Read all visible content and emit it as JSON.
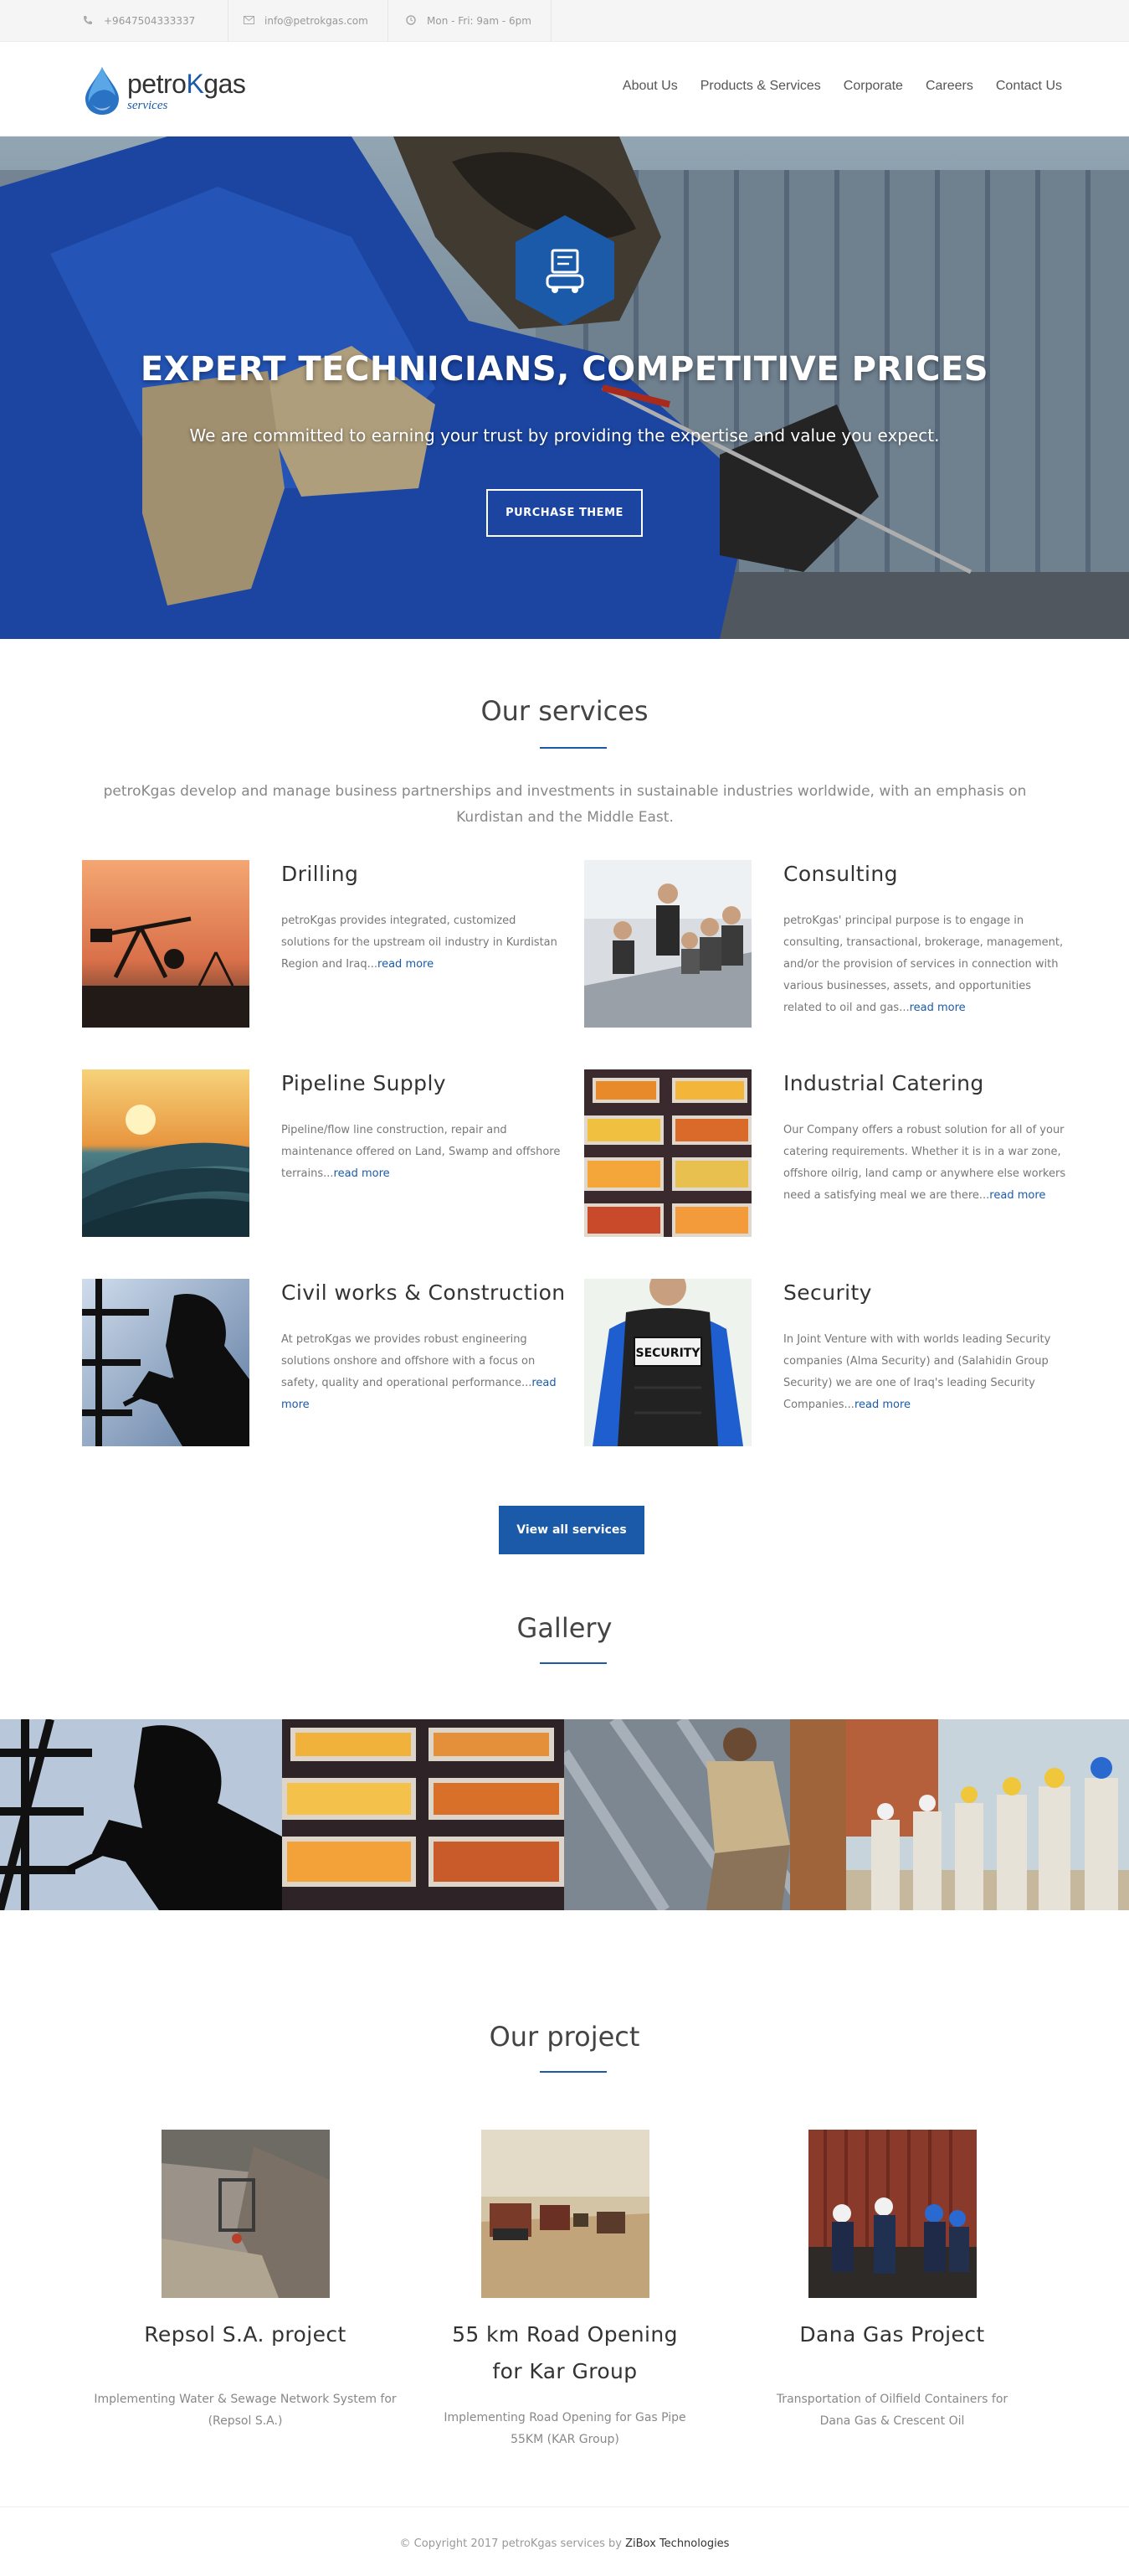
{
  "topbar": {
    "phone": "+9647504333337",
    "email": "info@petrokgas.com",
    "hours": "Mon - Fri: 9am - 6pm"
  },
  "logo": {
    "name_a": "petro",
    "name_k": "K",
    "name_b": "gas",
    "sub": "services"
  },
  "nav": [
    "About Us",
    "Products & Services",
    "Corporate",
    "Careers",
    "Contact Us"
  ],
  "hero": {
    "title": "EXPERT TECHNICIANS, COMPETITIVE PRICES",
    "subtitle": "We are committed to earning your trust by providing the expertise and value you expect.",
    "button": "PURCHASE THEME"
  },
  "services": {
    "title": "Our services",
    "intro": "petroKgas develop and manage business partnerships and investments in sustainable industries worldwide, with an emphasis on Kurdistan and the Middle East.",
    "items": [
      {
        "title": "Drilling",
        "desc": "petroKgas provides integrated, customized solutions for the upstream oil industry in Kurdistan Region and Iraq...",
        "more": "read more"
      },
      {
        "title": "Consulting",
        "desc": "petroKgas' principal purpose is to engage in consulting, transactional, brokerage, management, and/or the provision of services in connection with various businesses, assets, and opportunities related to oil and gas...",
        "more": "read more"
      },
      {
        "title": "Pipeline Supply",
        "desc": "Pipeline/flow line construction, repair and maintenance offered on Land, Swamp and offshore terrains...",
        "more": "read more"
      },
      {
        "title": "Industrial Catering",
        "desc": "Our Company offers a robust solution for all of your catering requirements. Whether it is in a war zone, offshore oilrig, land camp or anywhere else workers need a satisfying meal we are there...",
        "more": "read more"
      },
      {
        "title": "Civil works & Construction",
        "desc": "At petroKgas we provides robust engineering solutions onshore and offshore with a focus on safety, quality and operational performance...",
        "more": "read more"
      },
      {
        "title": "Security",
        "desc": "In Joint Venture with with worlds leading Security companies (Alma Security) and (Salahidin Group Security) we are one of Iraq's leading Security Companies...",
        "more": "read more"
      }
    ],
    "view_all": "View all services"
  },
  "gallery": {
    "title": "Gallery"
  },
  "projects": {
    "title": "Our project",
    "items": [
      {
        "title": "Repsol S.A. project",
        "desc": "Implementing Water & Sewage Network System for (Repsol S.A.)"
      },
      {
        "title": "55 km Road Opening for Kar Group",
        "desc": "Implementing Road Opening for Gas Pipe 55KM (KAR Group)"
      },
      {
        "title": "Dana Gas Project",
        "desc": "Transportation of Oilfield Containers for Dana Gas & Crescent Oil"
      }
    ]
  },
  "footer": {
    "copyright": "© Copyright 2017 petroKgas services by",
    "company": "ZiBox Technologies"
  },
  "security_badge": "SECURITY",
  "colors": {
    "brand": "#1a5aa8",
    "topbar": "#f5f5f5"
  }
}
